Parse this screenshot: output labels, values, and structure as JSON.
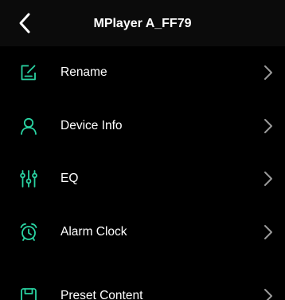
{
  "header": {
    "title": "MPlayer A_FF79",
    "back_icon": "chevron-left-icon"
  },
  "menu": {
    "items": [
      {
        "label": "Rename",
        "icon": "edit-icon"
      },
      {
        "label": "Device Info",
        "icon": "user-icon"
      },
      {
        "label": "EQ",
        "icon": "equalizer-icon"
      },
      {
        "label": "Alarm Clock",
        "icon": "alarm-clock-icon"
      },
      {
        "label": "Preset Content",
        "icon": "preset-icon"
      }
    ],
    "chevron_icon": "chevron-right-icon"
  },
  "colors": {
    "background": "#000000",
    "header_background": "#0b0b0b",
    "accent": "#2ad4a3",
    "text": "#ffffff",
    "chevron": "#9a9a9a"
  }
}
